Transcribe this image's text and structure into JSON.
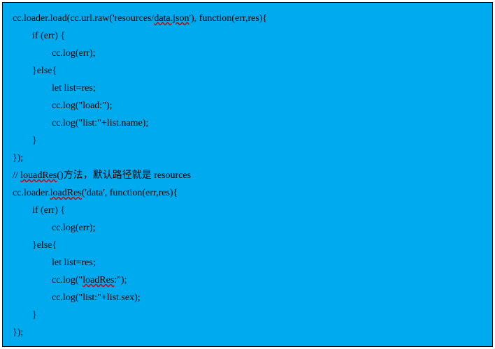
{
  "code": {
    "line1_a": "cc.loader.load(cc.url.raw('resources/",
    "line1_b": "data.json",
    "line1_c": "'), function(err,res){",
    "line2": "        if (err) {",
    "line3": "                cc.log(err);",
    "line4": "        }else{",
    "line5": "                let list=res;",
    "line6": "                cc.log(\"load:\");",
    "line7": "                cc.log(\"list:\"+list.name);",
    "line8": "        }",
    "line9": "});",
    "line10_a": "// ",
    "line10_b": "louadRes",
    "line10_c": "()方法，默认路径就是 resources",
    "line11_a": "cc.loader.",
    "line11_b": "loadRes",
    "line11_c": "('data', function(err,res){",
    "line12": "        if (err) {",
    "line13": "                cc.log(err);",
    "line14": "        }else{",
    "line15": "                let list=res;",
    "line16_a": "                cc.log(\"",
    "line16_b": "loadRes",
    "line16_c": ":\");",
    "line17": "                cc.log(\"list:\"+list.sex);",
    "line18": "        }",
    "line19": "});"
  }
}
